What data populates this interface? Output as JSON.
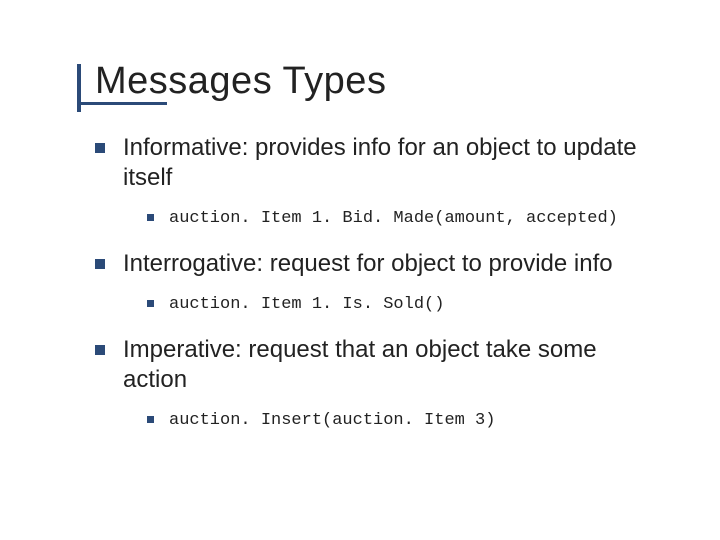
{
  "title": "Messages Types",
  "items": [
    {
      "text": "Informative: provides info for an object to update itself",
      "sub": [
        {
          "code": "auction. Item 1. Bid. Made(amount, accepted)"
        }
      ]
    },
    {
      "text": "Interrogative: request for object to provide info",
      "sub": [
        {
          "code": "auction. Item 1. Is. Sold()"
        }
      ]
    },
    {
      "text": "Imperative: request that an object take some action",
      "sub": [
        {
          "code": "auction. Insert(auction. Item 3)"
        }
      ]
    }
  ]
}
